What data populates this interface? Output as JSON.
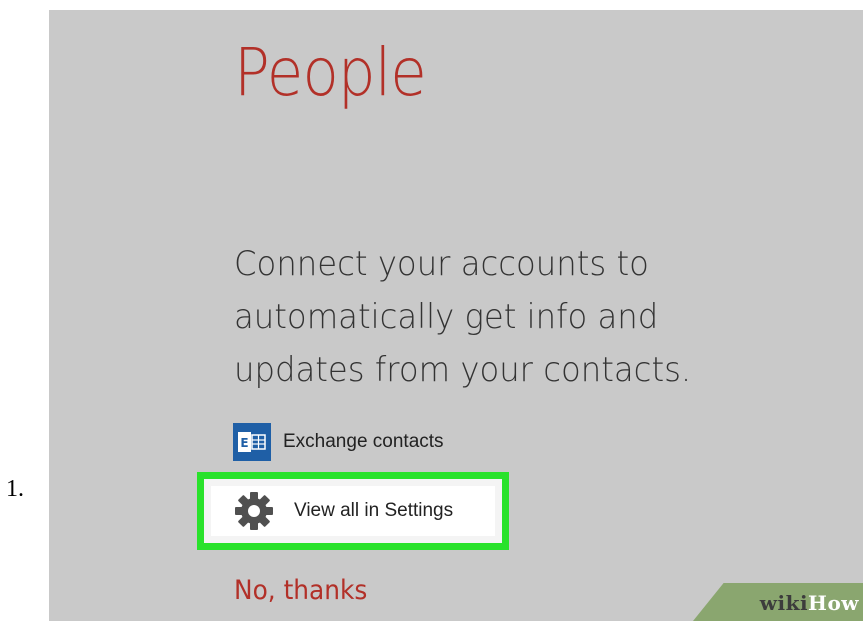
{
  "step": {
    "number": "1."
  },
  "app": {
    "title": "People",
    "accent_color": "#b23028"
  },
  "prompt": {
    "message_lines": [
      "Connect your accounts to",
      "automatically get info and",
      "updates from your contacts."
    ]
  },
  "accounts": {
    "exchange": {
      "label": "Exchange contacts",
      "icon": "exchange-icon",
      "icon_color": "#1f5fa6"
    }
  },
  "settings": {
    "label": "View all in Settings",
    "icon": "gear-icon",
    "highlight_color": "#29e22b"
  },
  "dismiss": {
    "label": "No, thanks"
  },
  "watermark": {
    "part1": "wiki",
    "part2": "How"
  }
}
